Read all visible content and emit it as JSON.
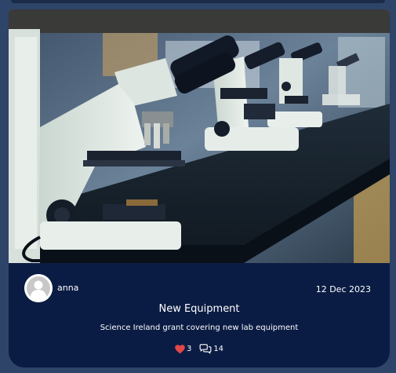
{
  "post": {
    "author": "anna",
    "date": "12 Dec 2023",
    "title": "New Equipment",
    "description": "Science Ireland grant covering new lab equipment",
    "likes": "3",
    "comments": "14"
  },
  "colors": {
    "page_background": "#2e4468",
    "card_background": "#0b1c44",
    "like_heart": "#e04848"
  },
  "icons": {
    "like": "heart-icon",
    "comment": "comments-icon",
    "avatar": "user-avatar-icon"
  }
}
